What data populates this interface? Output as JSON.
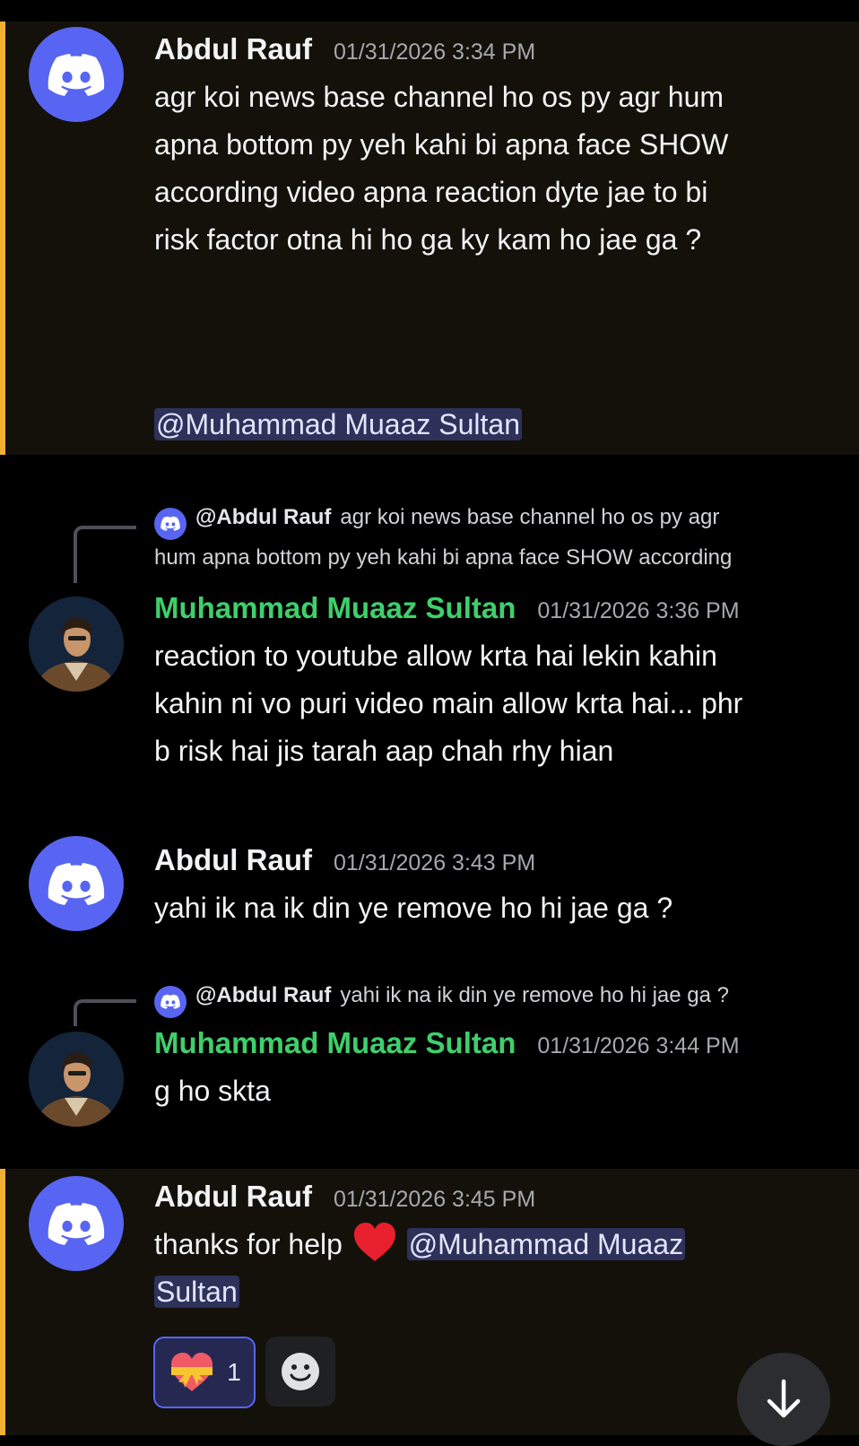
{
  "messages": [
    {
      "author": "Abdul Rauf",
      "timestamp": "01/31/2026 3:34 PM",
      "lines": [
        "agr koi news base channel ho os py agr hum",
        "apna bottom py yeh kahi bi apna face SHOW",
        "according video apna reaction dyte jae to bi",
        "risk factor otna hi ho ga ky kam ho jae ga ?"
      ],
      "mention": "@Muhammad Muaaz Sultan"
    },
    {
      "reply": {
        "author": "@Abdul Rauf",
        "line1": "agr koi news base channel ho os py agr",
        "line2": "hum apna bottom py yeh kahi bi apna face SHOW  according"
      },
      "author": "Muhammad Muaaz Sultan",
      "timestamp": "01/31/2026 3:36 PM",
      "lines": [
        "reaction to youtube allow krta hai lekin kahin",
        "kahin ni vo puri video main allow krta hai... phr",
        "b risk hai jis tarah aap chah rhy hian"
      ]
    },
    {
      "author": "Abdul Rauf",
      "timestamp": "01/31/2026 3:43 PM",
      "lines": [
        "yahi ik na ik din ye remove ho hi jae ga ?"
      ]
    },
    {
      "reply": {
        "author": "@Abdul Rauf",
        "line1": "yahi ik na ik din ye remove ho hi jae ga ?"
      },
      "author": "Muhammad Muaaz Sultan",
      "timestamp": "01/31/2026 3:44 PM",
      "lines": [
        "g ho skta"
      ]
    },
    {
      "author": "Abdul Rauf",
      "timestamp": "01/31/2026 3:45 PM",
      "text": "thanks for help",
      "emoji": "red-heart",
      "mention_part1": "@Muhammad Muaaz",
      "mention_part2": "Sultan",
      "reaction": {
        "emoji": "heart-with-ribbon",
        "count": "1"
      }
    }
  ],
  "icons": {
    "discord_avatar": "discord-logo-icon",
    "add_reaction": "smile-icon",
    "scroll_down": "arrow-down-icon"
  },
  "colors": {
    "highlight_bar": "#f0b132",
    "discord_blurple": "#5865f2",
    "green_name": "#3fcf6b",
    "mention_bg": "#2e3159"
  }
}
